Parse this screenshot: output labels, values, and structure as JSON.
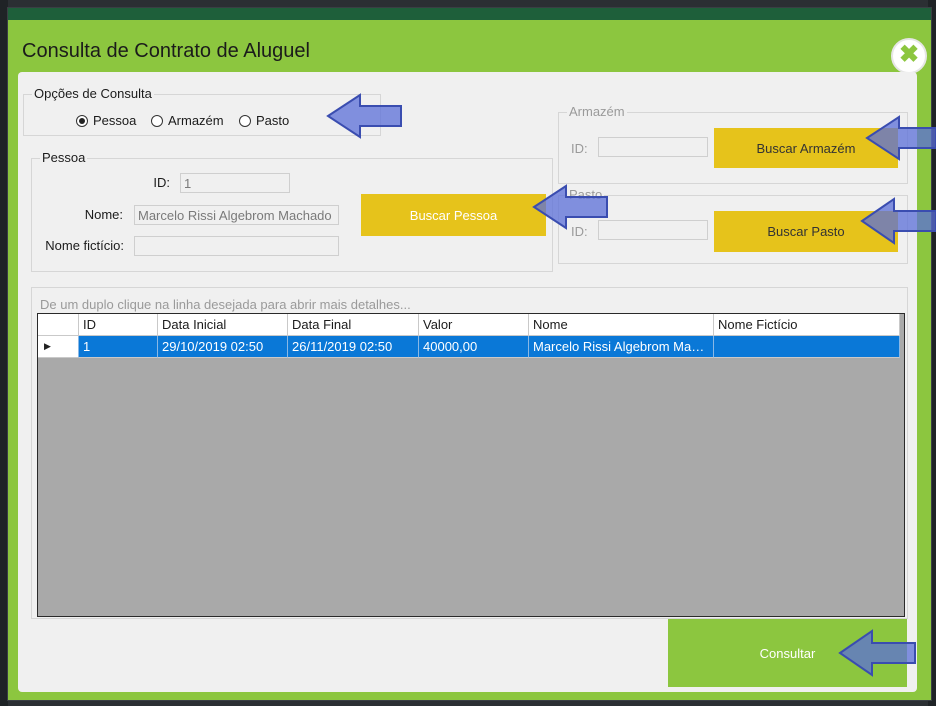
{
  "window": {
    "title": "Consulta de Contrato de Aluguel",
    "close_glyph": "✖"
  },
  "options": {
    "legend": "Opções de Consulta",
    "items": [
      "Pessoa",
      "Armazém",
      "Pasto"
    ],
    "selected": "Pessoa"
  },
  "pessoa": {
    "legend": "Pessoa",
    "id_label": "ID:",
    "id_value": "1",
    "nome_label": "Nome:",
    "nome_value": "Marcelo Rissi Algebrom Machado",
    "fict_label": "Nome fictício:",
    "fict_value": "",
    "search_label": "Buscar Pessoa"
  },
  "armazem": {
    "legend": "Armazém",
    "id_label": "ID:",
    "id_value": "",
    "search_label": "Buscar Armazém"
  },
  "pasto": {
    "legend": "Pasto",
    "id_label": "ID:",
    "id_value": "",
    "search_label": "Buscar Pasto"
  },
  "results": {
    "hint": "De um duplo clique na linha desejada para abrir mais detalhes...",
    "columns": [
      "ID",
      "Data Inicial",
      "Data Final",
      "Valor",
      "Nome",
      "Nome Fictício"
    ],
    "rows": [
      [
        "1",
        "29/10/2019 02:50",
        "26/11/2019 02:50",
        "40000,00",
        "Marcelo Rissi Algebrom Machado",
        ""
      ]
    ],
    "row_indicator": "▶"
  },
  "footer": {
    "consultar_label": "Consultar"
  },
  "colors": {
    "accent_green": "#8cc63f",
    "button_yellow": "#e6c31b",
    "selection_blue": "#0a78d7",
    "annotation_arrow": "#5b6fd8"
  }
}
